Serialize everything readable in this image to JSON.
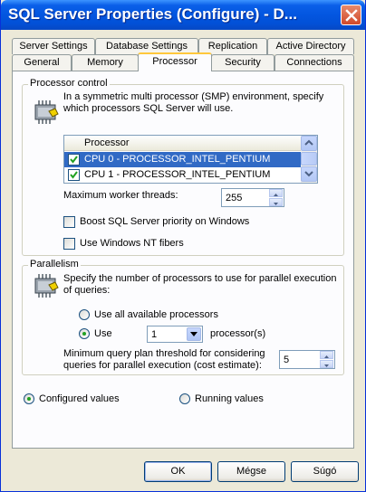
{
  "window": {
    "title": "SQL Server Properties (Configure)  - D..."
  },
  "tabs": {
    "row_back": [
      "Server Settings",
      "Database Settings",
      "Replication",
      "Active Directory"
    ],
    "row_front": [
      "General",
      "Memory",
      "Processor",
      "Security",
      "Connections"
    ],
    "active": "Processor"
  },
  "processor_control": {
    "group_label": "Processor control",
    "description": "In a symmetric multi processor (SMP) environment, specify which processors SQL Server will use.",
    "list": {
      "column_header": "Processor",
      "items": [
        {
          "label": "CPU 0 - PROCESSOR_INTEL_PENTIUM",
          "checked": true,
          "selected": true
        },
        {
          "label": "CPU 1 - PROCESSOR_INTEL_PENTIUM",
          "checked": true,
          "selected": false
        }
      ]
    },
    "max_worker_threads_label": "Maximum worker threads:",
    "max_worker_threads_value": "255",
    "boost_priority_label": "Boost SQL Server priority on Windows",
    "boost_priority_checked": false,
    "nt_fibers_label": "Use Windows NT fibers",
    "nt_fibers_checked": false
  },
  "parallelism": {
    "group_label": "Parallelism",
    "description": "Specify the number of processors to use for parallel execution of queries:",
    "use_all_label": "Use all available processors",
    "use_label": "Use",
    "use_value": "1",
    "use_suffix": "processor(s)",
    "selected_option": "use",
    "threshold_label": "Minimum query plan threshold for considering queries for parallel execution (cost estimate):",
    "threshold_value": "5"
  },
  "view_mode": {
    "configured_label": "Configured values",
    "running_label": "Running values",
    "selected": "configured"
  },
  "buttons": {
    "ok": "OK",
    "cancel": "Mégse",
    "help": "Súgó"
  },
  "colors": {
    "titlebar": "#0356e0",
    "selection": "#316ac5",
    "tab_highlight": "#ffc83c",
    "dialog_bg": "#ece9d8"
  }
}
